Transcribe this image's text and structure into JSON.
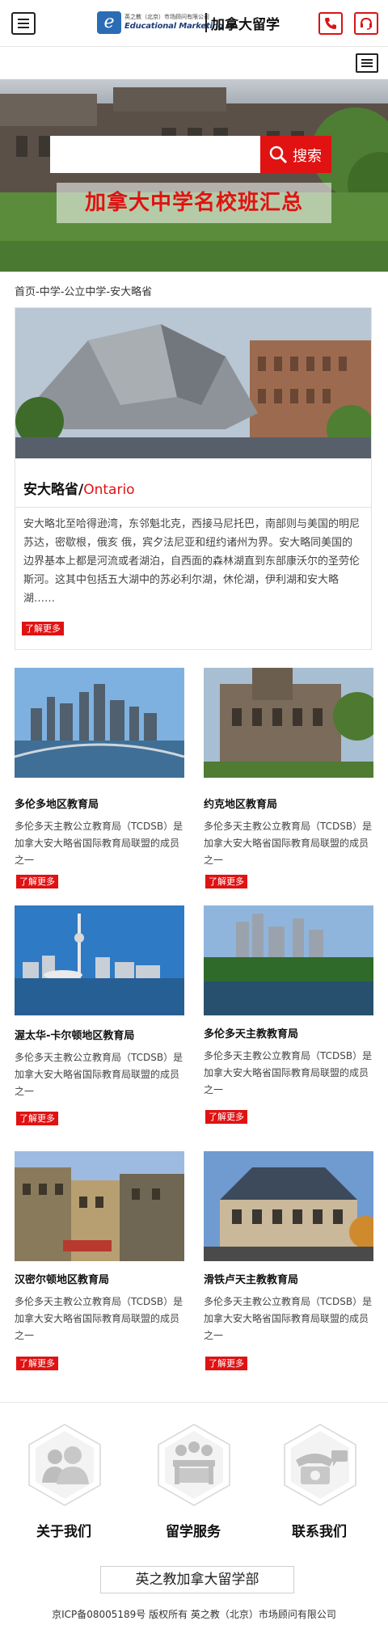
{
  "header": {
    "logo_cn": "英之教（北京）市场顾问有限公司",
    "logo_en": "Educational Marketing Co",
    "site_title": "加拿大留学",
    "menu_icon": "menu-icon",
    "phone_icon": "phone-icon",
    "service_icon": "headset-icon",
    "accent_color": "#e01212"
  },
  "hero": {
    "search_placeholder": "",
    "search_label": "搜索",
    "title": "加拿大中学名校班汇总"
  },
  "breadcrumb": "首页-中学-公立中学-安大略省",
  "province": {
    "name_cn": "安大略省/",
    "name_en": "Ontario",
    "description": "安大略北至哈得逊湾，东邻魁北克，西接马尼托巴，南部则与美国的明尼苏达，密歇根，俄亥 俄，宾夕法尼亚和纽约诸州为界。安大略同美国的边界基本上都是河流或者湖泊，自西面的森林湖直到东部康沃尔的圣劳伦斯河。这其中包括五大湖中的苏必利尔湖，休伦湖，伊利湖和安大略湖……",
    "more_label": "了解更多"
  },
  "boards": [
    {
      "name": "多伦多地区教育局",
      "desc": "多伦多天主教公立教育局（TCDSB）是加拿大安大略省国际教育局联盟的成员之一",
      "more": "了解更多"
    },
    {
      "name": "约克地区教育局",
      "desc": "多伦多天主教公立教育局（TCDSB）是加拿大安大略省国际教育局联盟的成员之一",
      "more": "了解更多"
    },
    {
      "name": "渥太华-卡尔顿地区教育局",
      "desc": "多伦多天主教公立教育局（TCDSB）是加拿大安大略省国际教育局联盟的成员之一",
      "more": "了解更多"
    },
    {
      "name": "多伦多天主教教育局",
      "desc": "多伦多天主教公立教育局（TCDSB）是加拿大安大略省国际教育局联盟的成员之一",
      "more": "了解更多"
    },
    {
      "name": "汉密尔顿地区教育局",
      "desc": "多伦多天主教公立教育局（TCDSB）是加拿大安大略省国际教育局联盟的成员之一",
      "more": "了解更多"
    },
    {
      "name": "滑铁卢天主教教育局",
      "desc": "多伦多天主教公立教育局（TCDSB）是加拿大安大略省国际教育局联盟的成员之一",
      "more": "了解更多"
    }
  ],
  "footer": {
    "nav": [
      {
        "label": "关于我们",
        "icon": "people-icon"
      },
      {
        "label": "留学服务",
        "icon": "meeting-icon"
      },
      {
        "label": "联系我们",
        "icon": "telephone-icon"
      }
    ],
    "brand": "英之教加拿大留学部",
    "copyright": "京ICP备08005189号 版权所有 英之教（北京）市场顾问有限公司"
  }
}
